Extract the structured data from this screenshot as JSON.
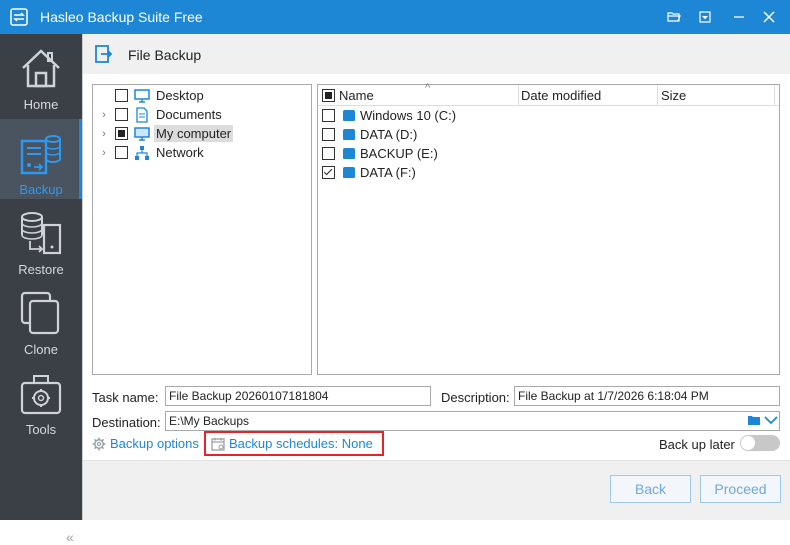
{
  "window": {
    "title": "Hasleo Backup Suite Free"
  },
  "sidebar": {
    "items": [
      {
        "label": "Home",
        "icon": "home-icon"
      },
      {
        "label": "Backup",
        "icon": "backup-icon",
        "active": true
      },
      {
        "label": "Restore",
        "icon": "restore-icon"
      },
      {
        "label": "Clone",
        "icon": "clone-icon"
      },
      {
        "label": "Tools",
        "icon": "tools-icon"
      }
    ],
    "collapse_glyph": "«"
  },
  "page": {
    "title": "File Backup"
  },
  "tree": {
    "items": [
      {
        "label": "Desktop",
        "expandable": false,
        "state": "unchecked"
      },
      {
        "label": "Documents",
        "expandable": true,
        "state": "unchecked"
      },
      {
        "label": "My computer",
        "expandable": true,
        "state": "partial",
        "selected": true
      },
      {
        "label": "Network",
        "expandable": true,
        "state": "unchecked"
      }
    ]
  },
  "file_list": {
    "columns": {
      "name": "Name",
      "date_modified": "Date modified",
      "size": "Size"
    },
    "header_state": "partial",
    "rows": [
      {
        "name": "Windows 10 (C:)",
        "checked": false
      },
      {
        "name": "DATA (D:)",
        "checked": false
      },
      {
        "name": "BACKUP (E:)",
        "checked": false
      },
      {
        "name": "DATA (F:)",
        "checked": true
      }
    ]
  },
  "form": {
    "task_name_label": "Task name:",
    "task_name_value": "File Backup 20260107181804",
    "description_label": "Description:",
    "description_value": "File Backup at 1/7/2026 6:18:04 PM",
    "destination_label": "Destination:",
    "destination_value": "E:\\My Backups"
  },
  "links": {
    "backup_options": "Backup options",
    "backup_schedules": "Backup schedules: None"
  },
  "backup_later": {
    "label": "Back up later",
    "enabled": false
  },
  "buttons": {
    "back": "Back",
    "proceed": "Proceed"
  },
  "colors": {
    "accent": "#1d87d6",
    "sidebar": "#3b3f46",
    "highlight": "#e0252b"
  }
}
